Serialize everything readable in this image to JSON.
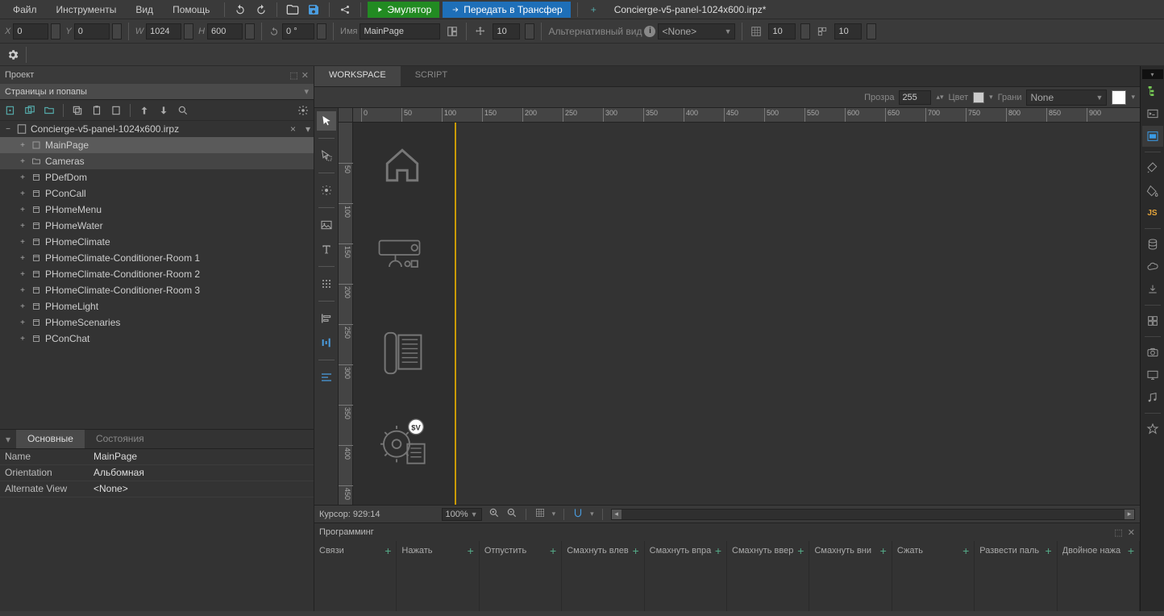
{
  "menu": {
    "file": "Файл",
    "tools": "Инструменты",
    "view": "Вид",
    "help": "Помощь"
  },
  "top_buttons": {
    "emulator": "Эмулятор",
    "transfer": "Передать в Трансфер"
  },
  "document_tab": "Concierge-v5-panel-1024x600.irpz*",
  "tb2": {
    "x_lbl": "X",
    "x": "0",
    "y_lbl": "Y",
    "y": "0",
    "w_lbl": "W",
    "w": "1024",
    "h_lbl": "H",
    "h": "600",
    "deg": "0 °",
    "name_lbl": "Имя",
    "name": "MainPage",
    "snap1": "10",
    "altview_lbl": "Альтернативный вид",
    "altview": "<None>",
    "snap2": "10",
    "snap3": "10"
  },
  "project": {
    "panel_title": "Проект",
    "sub_title": "Страницы и попапы",
    "root": "Concierge-v5-panel-1024x600.irpz",
    "items": [
      "MainPage",
      "Cameras",
      "PDefDom",
      "PConCall",
      "PHomeMenu",
      "PHomeWater",
      "PHomeClimate",
      "PHomeClimate-Conditioner-Room 1",
      "PHomeClimate-Conditioner-Room 2",
      "PHomeClimate-Conditioner-Room 3",
      "PHomeLight",
      "PHomeScenaries",
      "PConChat"
    ]
  },
  "props": {
    "tab_main": "Основные",
    "tab_states": "Состояния",
    "rows": [
      {
        "n": "Name",
        "v": "MainPage"
      },
      {
        "n": "Orientation",
        "v": "Альбомная"
      },
      {
        "n": "Alternate View",
        "v": "<None>"
      }
    ]
  },
  "ws": {
    "tab_workspace": "WORKSPACE",
    "tab_script": "SCRIPT"
  },
  "canvas_bar": {
    "transp_lbl": "Прозра",
    "transp": "255",
    "color_lbl": "Цвет",
    "border_lbl": "Грани",
    "border": "None"
  },
  "status": {
    "cursor": "Курсор: 929:14",
    "zoom": "100%"
  },
  "programming": {
    "title": "Программинг",
    "cols": [
      "Связи",
      "Нажать",
      "Отпустить",
      "Смахнуть влев",
      "Смахнуть впра",
      "Смахнуть ввер",
      "Смахнуть вни",
      "Сжать",
      "Развести паль",
      "Двойное нажа"
    ]
  },
  "ruler_major": [
    0,
    50,
    100,
    150,
    200,
    250,
    300,
    350,
    400,
    450,
    500,
    550,
    600,
    650,
    700,
    750,
    800,
    850,
    900
  ],
  "ruler_v": [
    50,
    100,
    150,
    200,
    250,
    300,
    350,
    400,
    450
  ]
}
